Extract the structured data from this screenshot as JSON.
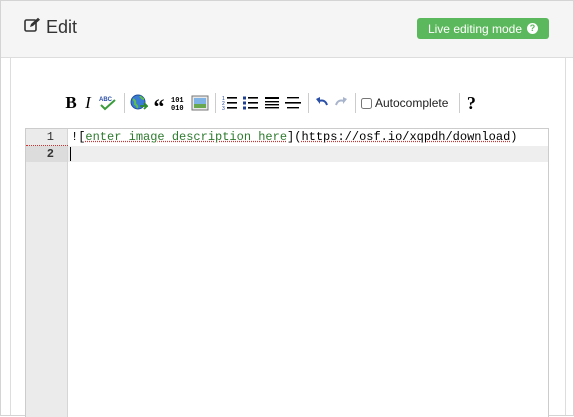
{
  "header": {
    "title": "Edit",
    "live_button": {
      "label": "Live editing mode",
      "icon": "question-circle-icon",
      "color": "#5cb85c"
    }
  },
  "toolbar": {
    "bold": "B",
    "italic": "I",
    "spellcheck_icon": "spellcheck-abc-icon",
    "link_icon": "globe-link-icon",
    "quote": "“",
    "code_icon": "binary-code-icon",
    "image_icon": "image-icon",
    "ordered_list_icon": "ordered-list-icon",
    "unordered_list_icon": "bullet-list-icon",
    "heading_icon": "heading-icon",
    "hr_icon": "horizontal-rule-icon",
    "undo_icon": "undo-icon",
    "redo_icon": "redo-icon",
    "autocomplete_label": "Autocomplete",
    "autocomplete_checked": false,
    "help": "?"
  },
  "editor": {
    "line_numbers": [
      "1",
      "2"
    ],
    "line1": {
      "bang": "!",
      "open_bracket": "[",
      "alt_text": "enter image description here",
      "close_bracket": "]",
      "open_paren": "(",
      "url": "https://osf.io/xqpdh/download",
      "close_paren": ")"
    },
    "line2": ""
  }
}
